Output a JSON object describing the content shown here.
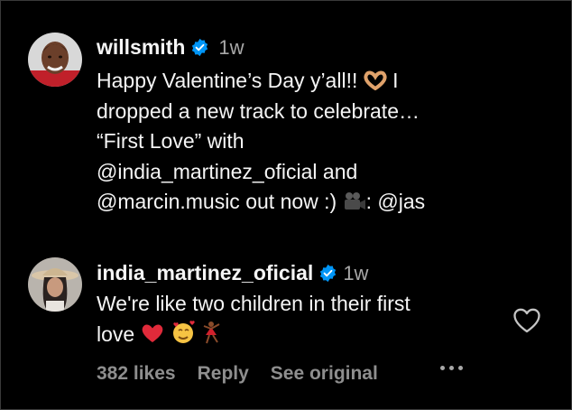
{
  "post": {
    "username": "willsmith",
    "time": "1w",
    "lines": [
      "Happy Valentine’s Day y’all!! ",
      "dropped a new track to celebrate…",
      "“First Love” with",
      "@india_martinez_oficial and",
      "@marcin.music out now :) ",
      ": @jas"
    ],
    "line1_tail": " I"
  },
  "comment": {
    "username": "india_martinez_oficial",
    "time": "1w",
    "line1": "We're like two children in their first",
    "line2": "love ",
    "likes": "382 likes",
    "reply": "Reply",
    "see_original": "See original"
  },
  "icons": {
    "verified": "verified-badge-icon",
    "like": "heart-outline-icon",
    "more": "more-options-icon",
    "heart_hands": "heart-hands-emoji",
    "camera": "movie-camera-emoji",
    "red_heart": "red-heart-emoji",
    "smiling_hearts": "smiling-face-with-hearts-emoji",
    "dancer": "dancer-emoji"
  },
  "colors": {
    "background": "#000000",
    "text": "#f5f5f5",
    "muted": "#8e8e8e",
    "verified": "#0095f6"
  }
}
